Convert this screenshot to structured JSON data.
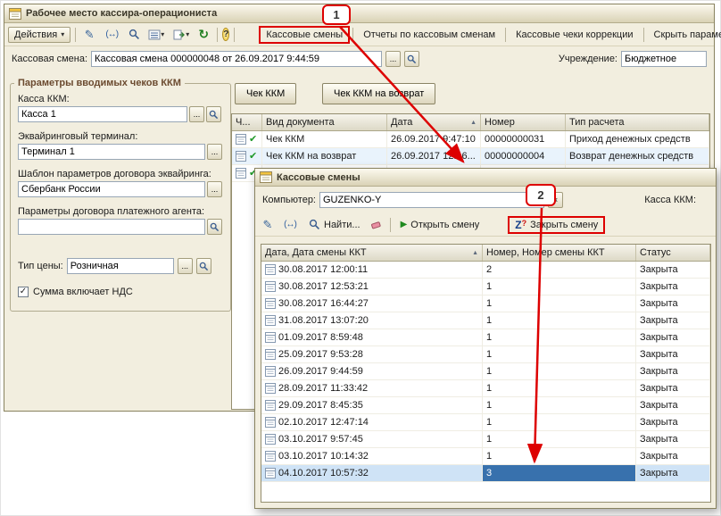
{
  "annotations": {
    "step1": "1",
    "step2": "2",
    "color": "#dd0000"
  },
  "icons": {
    "dropdown": "▾",
    "pencil": "✎",
    "swap_arrows": "(↔)",
    "refresh": "↻",
    "help": "?",
    "play": "▶",
    "check_mark": "✔",
    "checkbox_check": "✓",
    "sort_asc": "▲",
    "close_x": "×",
    "ellipsis": "...",
    "z_letter": "Z",
    "red_question": "?"
  },
  "main_window": {
    "title": "Рабочее место кассира-операциониста",
    "toolbar": {
      "actions": "Действия",
      "buttons": [
        "Кассовые смены",
        "Отчеты по кассовым сменам",
        "Кассовые чеки коррекции",
        "Скрыть параметры"
      ]
    },
    "fields": {
      "shift_label": "Кассовая смена:",
      "shift_value": "Кассовая смена 000000048 от 26.09.2017 9:44:59",
      "institution_label": "Учреждение:",
      "institution_value": "Бюджетное"
    },
    "params": {
      "title": "Параметры вводимых чеков ККМ",
      "kkm_label": "Касса ККМ:",
      "kkm_value": "Касса 1",
      "terminal_label": "Эквайринговый терминал:",
      "terminal_value": "Терминал 1",
      "template_label": "Шаблон параметров договора эквайринга:",
      "template_value": "Сбербанк России",
      "agent_label": "Параметры договора платежного агента:",
      "agent_value": "",
      "price_label": "Тип цены:",
      "price_value": "Розничная",
      "vat_checkbox": "Сумма включает НДС"
    },
    "doc_buttons": {
      "check": "Чек ККМ",
      "refund": "Чек ККМ на возврат"
    },
    "table": {
      "columns": [
        "Ч...",
        "Вид документа",
        "Дата",
        "Номер",
        "Тип расчета"
      ],
      "rows": [
        {
          "doc": "Чек ККМ",
          "date": "26.09.2017 9:47:10",
          "number": "00000000031",
          "type": "Приход денежных средств"
        },
        {
          "doc": "Чек ККМ на возврат",
          "date": "26.09.2017 12:16...",
          "number": "00000000004",
          "type": "Возврат денежных средств"
        },
        {
          "doc": "",
          "date": "",
          "number": "",
          "type": ""
        }
      ]
    }
  },
  "shifts_window": {
    "title": "Кассовые смены",
    "computer_label": "Компьютер:",
    "computer_value": "GUZENKO-Y",
    "kkm_label": "Касса ККМ:",
    "toolbar": {
      "find": "Найти...",
      "open_shift": "Открыть смену",
      "close_shift": "Закрыть смену"
    },
    "table": {
      "columns": [
        "Дата, Дата смены ККТ",
        "Номер, Номер смены ККТ",
        "Статус"
      ],
      "selected_index": 12,
      "rows": [
        {
          "date": "30.08.2017 12:00:11",
          "number": "2",
          "status": "Закрыта"
        },
        {
          "date": "30.08.2017 12:53:21",
          "number": "1",
          "status": "Закрыта"
        },
        {
          "date": "30.08.2017 16:44:27",
          "number": "1",
          "status": "Закрыта"
        },
        {
          "date": "31.08.2017 13:07:20",
          "number": "1",
          "status": "Закрыта"
        },
        {
          "date": "01.09.2017 8:59:48",
          "number": "1",
          "status": "Закрыта"
        },
        {
          "date": "25.09.2017 9:53:28",
          "number": "1",
          "status": "Закрыта"
        },
        {
          "date": "26.09.2017 9:44:59",
          "number": "1",
          "status": "Закрыта"
        },
        {
          "date": "28.09.2017 11:33:42",
          "number": "1",
          "status": "Закрыта"
        },
        {
          "date": "29.09.2017 8:45:35",
          "number": "1",
          "status": "Закрыта"
        },
        {
          "date": "02.10.2017 12:47:14",
          "number": "1",
          "status": "Закрыта"
        },
        {
          "date": "03.10.2017 9:57:45",
          "number": "1",
          "status": "Закрыта"
        },
        {
          "date": "03.10.2017 10:14:32",
          "number": "1",
          "status": "Закрыта"
        },
        {
          "date": "04.10.2017 10:57:32",
          "number": "3",
          "status": "Закрыта"
        }
      ]
    }
  }
}
